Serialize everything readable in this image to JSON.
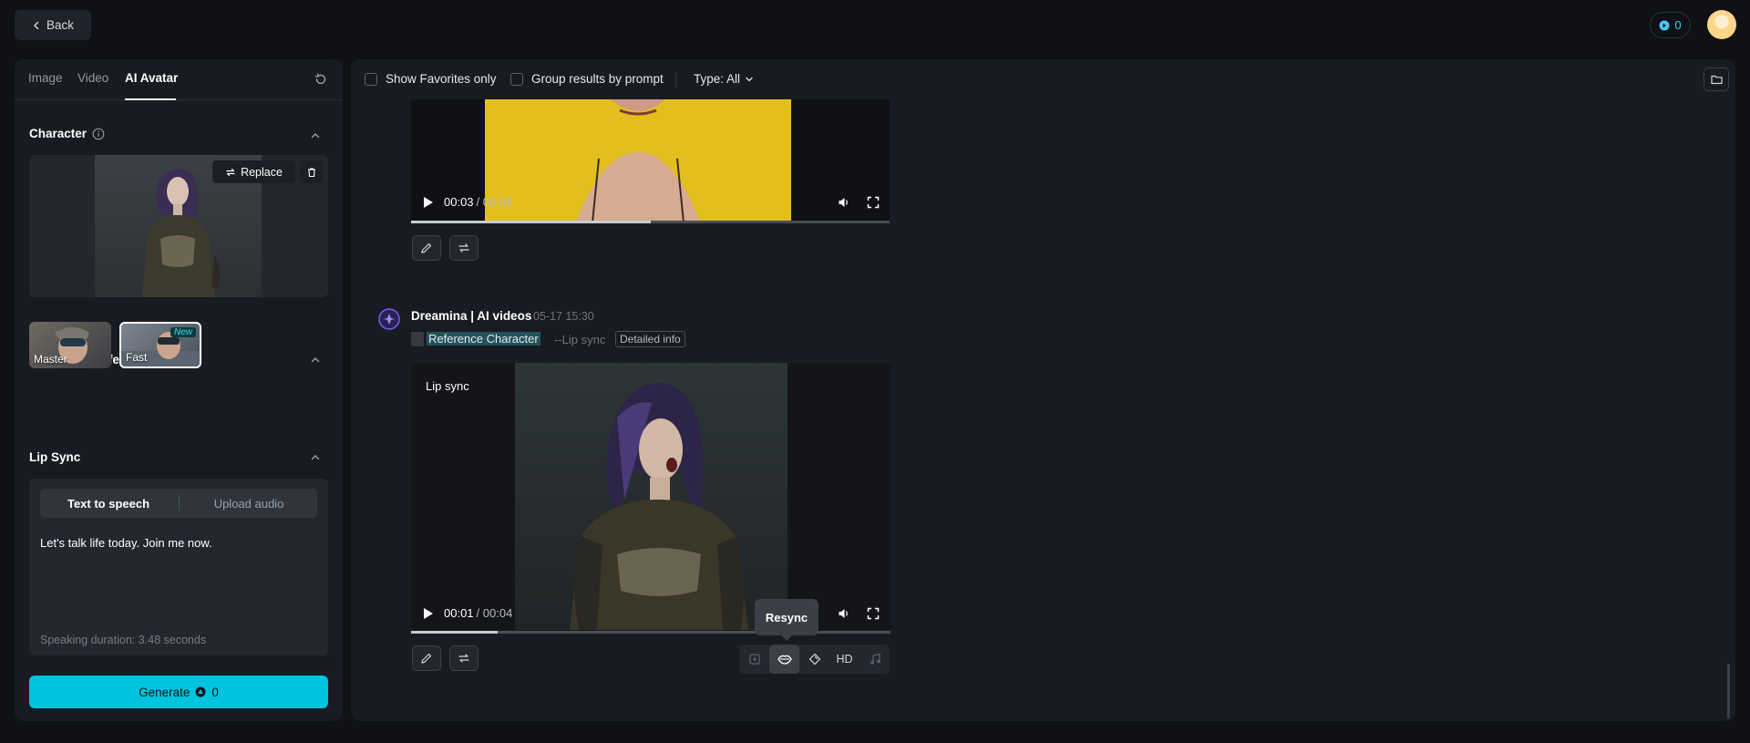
{
  "topbar": {
    "back_label": "Back",
    "credits": "0"
  },
  "left_panel": {
    "tabs": [
      {
        "label": "Image"
      },
      {
        "label": "Video"
      },
      {
        "label": "AI Avatar"
      }
    ],
    "character": {
      "title": "Character",
      "replace_label": "Replace"
    },
    "generation_effect": {
      "title": "Generation effect",
      "options": [
        {
          "label": "Master"
        },
        {
          "label": "Fast",
          "badge": "New"
        }
      ]
    },
    "lip_sync": {
      "title": "Lip Sync",
      "tabs": [
        {
          "label": "Text to speech"
        },
        {
          "label": "Upload audio"
        }
      ],
      "text": "Let's talk life today. Join me now.",
      "duration": "Speaking duration: 3.48 seconds"
    },
    "generate": {
      "label": "Generate",
      "cost": "0"
    }
  },
  "right_panel": {
    "filters": {
      "favorites_label": "Show Favorites only",
      "group_label": "Group results by prompt",
      "type_label": "Type: All"
    },
    "video1": {
      "current": "00:03",
      "total": "/ 00:06",
      "progress": 0.5
    },
    "entry": {
      "name": "Dreamina | AI videos",
      "date": "05-17  15:30",
      "ref_label": "Reference Character",
      "mode_label": "--Lip sync",
      "detail_label": "Detailed info"
    },
    "video2": {
      "overlay_label": "Lip sync",
      "current": "00:01",
      "total": "/ 00:04",
      "progress": 0.18
    },
    "actions": {
      "hd_label": "HD",
      "tooltip": "Resync"
    }
  }
}
